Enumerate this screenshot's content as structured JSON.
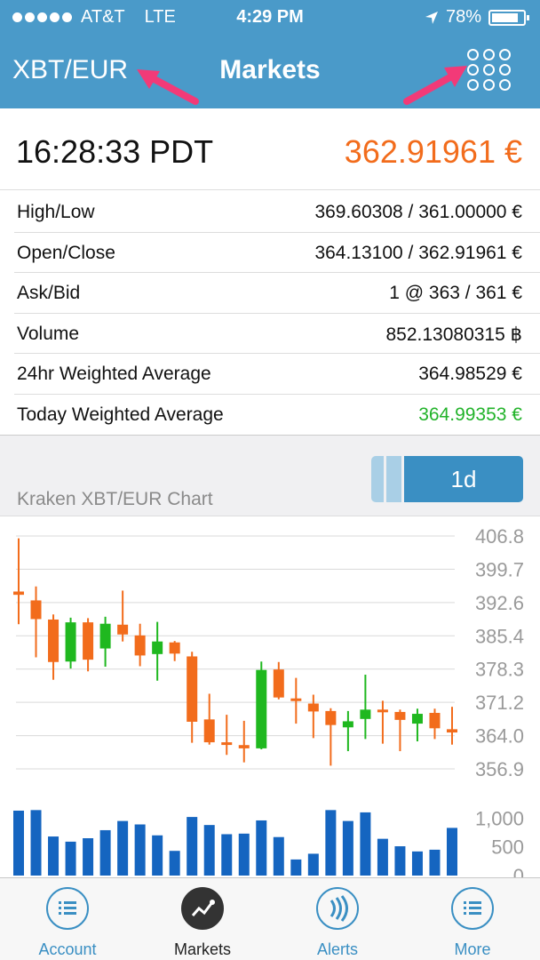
{
  "status_bar": {
    "carrier": "AT&T",
    "network": "LTE",
    "time": "4:29 PM",
    "battery": "78%"
  },
  "nav": {
    "pair": "XBT/EUR",
    "title": "Markets"
  },
  "ticker": {
    "time": "16:28:33 PDT",
    "price": "362.91961 €",
    "price_color": "#f26c1c"
  },
  "stats": [
    {
      "label": "High/Low",
      "value": "369.60308 / 361.00000 €"
    },
    {
      "label": "Open/Close",
      "value": "364.13100 / 362.91961 €"
    },
    {
      "label": "Ask/Bid",
      "value": "1 @ 363 / 361 €"
    },
    {
      "label": "Volume",
      "value": "852.13080315 ฿"
    },
    {
      "label": "24hr Weighted Average",
      "value": "364.98529 €"
    },
    {
      "label": "Today Weighted Average",
      "value": "364.99353 €",
      "color": "#22b32a"
    }
  ],
  "chart_header": {
    "period": "1d",
    "title": "Kraken XBT/EUR Chart"
  },
  "chart_data": {
    "type": "candlestick",
    "price_axis_ticks": [
      "406.8",
      "399.7",
      "392.6",
      "385.4",
      "378.3",
      "371.2",
      "364.0",
      "356.9"
    ],
    "price_ylim": [
      356.9,
      406.8
    ],
    "volume_axis_ticks": [
      "1,000",
      "500",
      "0"
    ],
    "up_color": "#1fb81f",
    "down_color": "#f26c1c",
    "volume_color": "#1565c0",
    "candles": [
      {
        "open": 394.9,
        "close": 394.2,
        "high": 406.3,
        "low": 387.9
      },
      {
        "open": 393.0,
        "close": 389.0,
        "high": 396.0,
        "low": 380.8
      },
      {
        "open": 388.9,
        "close": 379.8,
        "high": 390.0,
        "low": 376.0
      },
      {
        "open": 379.9,
        "close": 388.3,
        "high": 389.3,
        "low": 378.4
      },
      {
        "open": 388.3,
        "close": 380.3,
        "high": 389.2,
        "low": 377.8
      },
      {
        "open": 382.7,
        "close": 388.0,
        "high": 389.5,
        "low": 378.8
      },
      {
        "open": 387.8,
        "close": 385.7,
        "high": 395.1,
        "low": 384.2
      },
      {
        "open": 385.5,
        "close": 381.2,
        "high": 388.0,
        "low": 378.9
      },
      {
        "open": 381.5,
        "close": 384.2,
        "high": 388.4,
        "low": 375.8
      },
      {
        "open": 384.0,
        "close": 381.6,
        "high": 384.3,
        "low": 380.0
      },
      {
        "open": 381.0,
        "close": 367.0,
        "high": 382.0,
        "low": 362.5
      },
      {
        "open": 367.5,
        "close": 362.6,
        "high": 373.0,
        "low": 362.1
      },
      {
        "open": 362.6,
        "close": 362.3,
        "high": 368.5,
        "low": 359.9
      },
      {
        "open": 362.0,
        "close": 361.3,
        "high": 367.2,
        "low": 358.3
      },
      {
        "open": 361.3,
        "close": 378.1,
        "high": 379.9,
        "low": 361.1
      },
      {
        "open": 378.2,
        "close": 372.2,
        "high": 379.8,
        "low": 371.8
      },
      {
        "open": 372.0,
        "close": 371.8,
        "high": 376.4,
        "low": 366.6
      },
      {
        "open": 370.9,
        "close": 369.2,
        "high": 372.8,
        "low": 363.5
      },
      {
        "open": 369.3,
        "close": 366.3,
        "high": 369.9,
        "low": 357.6
      },
      {
        "open": 365.8,
        "close": 367.1,
        "high": 369.3,
        "low": 360.7
      },
      {
        "open": 367.6,
        "close": 369.6,
        "high": 377.1,
        "low": 363.3
      },
      {
        "open": 369.6,
        "close": 369.1,
        "high": 371.5,
        "low": 362.3
      },
      {
        "open": 369.1,
        "close": 367.4,
        "high": 369.6,
        "low": 360.7
      },
      {
        "open": 366.6,
        "close": 368.7,
        "high": 369.8,
        "low": 362.8
      },
      {
        "open": 368.9,
        "close": 365.6,
        "high": 369.8,
        "low": 363.3
      },
      {
        "open": 365.4,
        "close": 364.7,
        "high": 370.2,
        "low": 362.1
      }
    ],
    "volumes": [
      1130,
      1140,
      680,
      590,
      650,
      790,
      950,
      890,
      700,
      430,
      1020,
      880,
      720,
      730,
      960,
      670,
      280,
      380,
      1140,
      950,
      1100,
      640,
      510,
      420,
      450,
      830
    ],
    "volume_ylim": [
      0,
      1300
    ]
  },
  "tabs": [
    {
      "label": "Account",
      "icon": "list-icon",
      "active": false
    },
    {
      "label": "Markets",
      "icon": "trend-line-icon",
      "active": true
    },
    {
      "label": "Alerts",
      "icon": "signal-waves-icon",
      "active": false
    },
    {
      "label": "More",
      "icon": "list-icon",
      "active": false
    }
  ]
}
